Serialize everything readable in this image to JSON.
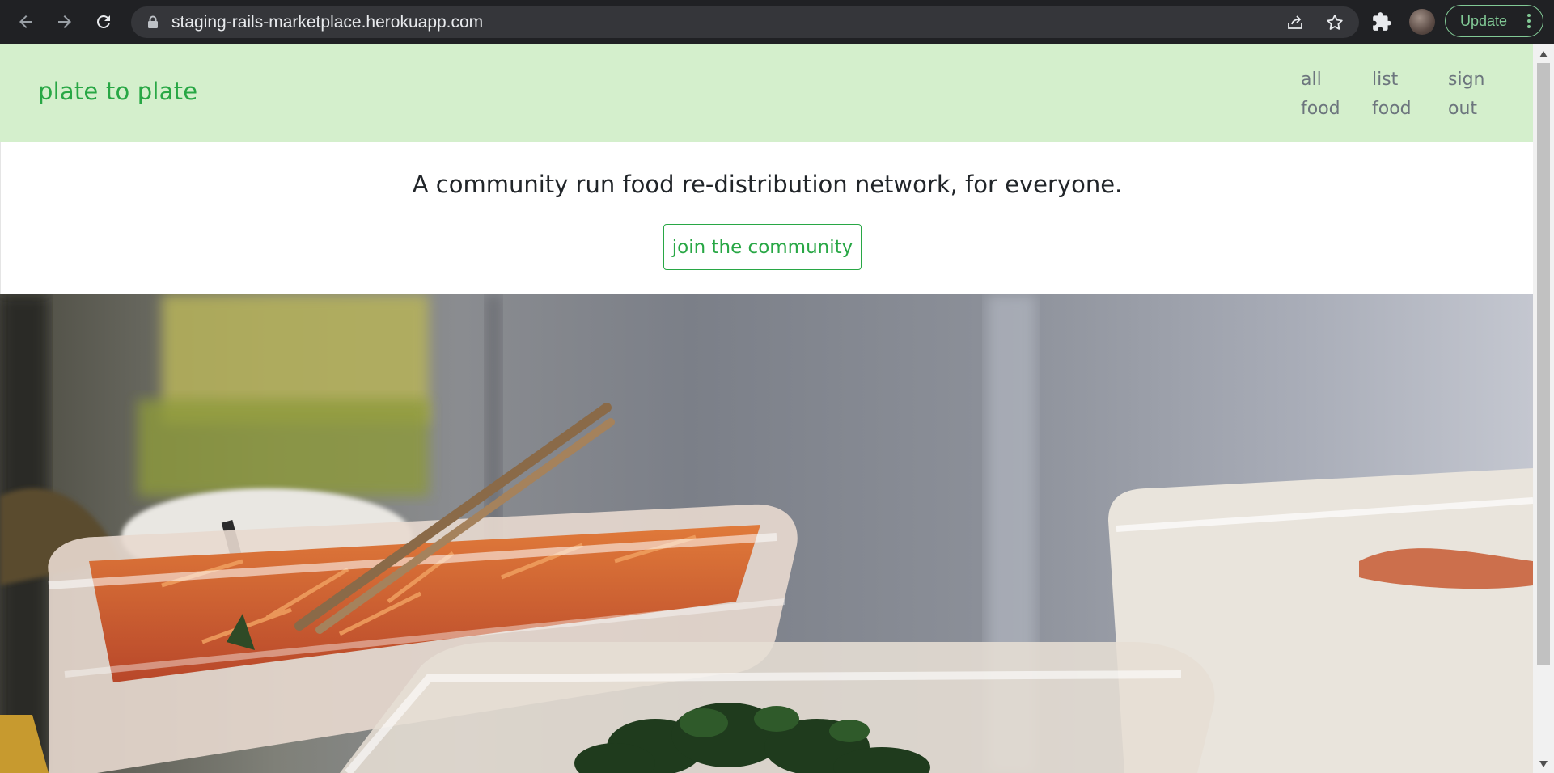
{
  "browser": {
    "url": "staging-rails-marketplace.herokuapp.com",
    "update_label": "Update"
  },
  "navbar": {
    "brand": "plate to plate",
    "links": [
      {
        "line1": "all",
        "line2": "food"
      },
      {
        "line1": "list",
        "line2": "food"
      },
      {
        "line1": "sign",
        "line2": "out"
      }
    ]
  },
  "hero": {
    "tagline": "A community run food re-distribution network, for everyone.",
    "cta": "join the community"
  },
  "colors": {
    "brand_green": "#28a745",
    "navbar_bg": "#d4efcc",
    "nav_link": "#6c757d"
  }
}
